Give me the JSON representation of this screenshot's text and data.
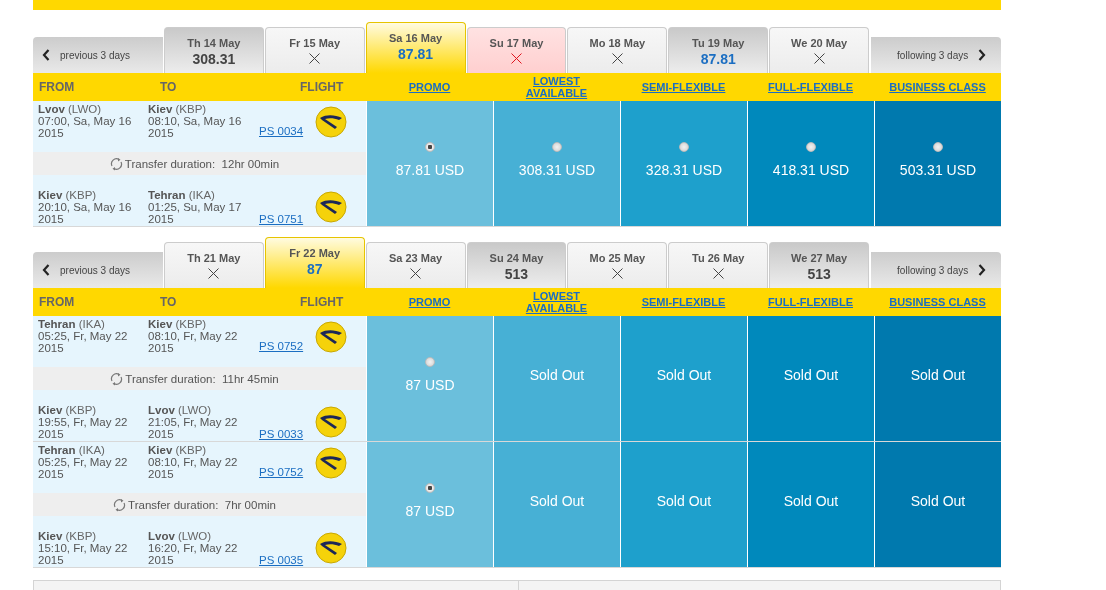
{
  "blocks": [
    {
      "prev_label": "previous 3 days",
      "next_label": "following 3 days",
      "dates": [
        {
          "label": "Th 14 May",
          "kind": "price",
          "price": "308.31",
          "highlighted": false,
          "selected": false
        },
        {
          "label": "Fr 15 May",
          "kind": "none",
          "selected": false
        },
        {
          "label": "Sa 16 May",
          "kind": "price",
          "price": "87.81",
          "highlighted": true,
          "selected": true
        },
        {
          "label": "Su 17 May",
          "kind": "blocked",
          "selected": false
        },
        {
          "label": "Mo 18 May",
          "kind": "none",
          "selected": false
        },
        {
          "label": "Tu 19 May",
          "kind": "price",
          "price": "87.81",
          "highlighted": true,
          "selected": false
        },
        {
          "label": "We 20 May",
          "kind": "none",
          "selected": false
        }
      ],
      "headers": {
        "from": "FROM",
        "to": "TO",
        "flight": "FLIGHT"
      },
      "fare_classes": [
        {
          "label": "PROMO",
          "color": "#6bbfdc"
        },
        {
          "label": "LOWEST AVAILABLE",
          "color": "#47b0d5"
        },
        {
          "label": "SEMI-FLEXIBLE",
          "color": "#1ea0cc"
        },
        {
          "label": "FULL-FLEXIBLE",
          "color": "#0089bc"
        },
        {
          "label": "BUSINESS CLASS",
          "color": "#0079ae"
        }
      ],
      "itineraries": [
        {
          "segments": [
            {
              "from_city": "Lvov",
              "from_code": "(LWO)",
              "from_time": [
                "07:00, Sa, May 16",
                "2015"
              ],
              "to_city": "Kiev",
              "to_code": "(KBP)",
              "to_time": [
                "08:10, Sa, May 16",
                "2015"
              ],
              "flight": "PS 0034"
            },
            {
              "from_city": "Kiev",
              "from_code": "(KBP)",
              "from_time": [
                "20:10, Sa, May 16",
                "2015"
              ],
              "to_city": "Tehran",
              "to_code": "(IKA)",
              "to_time": [
                "01:25, Su, May 17",
                "2015"
              ],
              "flight": "PS 0751"
            }
          ],
          "transfer": {
            "label": "Transfer duration:",
            "duration": "12hr 00min"
          },
          "fares": [
            {
              "kind": "radio",
              "selected": true,
              "price": "87.81 USD"
            },
            {
              "kind": "radio",
              "selected": false,
              "price": "308.31 USD"
            },
            {
              "kind": "radio",
              "selected": false,
              "price": "328.31 USD"
            },
            {
              "kind": "radio",
              "selected": false,
              "price": "418.31 USD"
            },
            {
              "kind": "radio",
              "selected": false,
              "price": "503.31 USD"
            }
          ]
        }
      ]
    },
    {
      "prev_label": "previous 3 days",
      "next_label": "following 3 days",
      "dates": [
        {
          "label": "Th 21 May",
          "kind": "none",
          "selected": false
        },
        {
          "label": "Fr 22 May",
          "kind": "price",
          "price": "87",
          "highlighted": true,
          "selected": true
        },
        {
          "label": "Sa 23 May",
          "kind": "none",
          "selected": false
        },
        {
          "label": "Su 24 May",
          "kind": "price",
          "price": "513",
          "highlighted": false,
          "selected": false
        },
        {
          "label": "Mo 25 May",
          "kind": "none",
          "selected": false
        },
        {
          "label": "Tu 26 May",
          "kind": "none",
          "selected": false
        },
        {
          "label": "We 27 May",
          "kind": "price",
          "price": "513",
          "highlighted": false,
          "selected": false
        }
      ],
      "headers": {
        "from": "FROM",
        "to": "TO",
        "flight": "FLIGHT"
      },
      "fare_classes": [
        {
          "label": "PROMO",
          "color": "#6bbfdc"
        },
        {
          "label": "LOWEST AVAILABLE",
          "color": "#47b0d5"
        },
        {
          "label": "SEMI-FLEXIBLE",
          "color": "#1ea0cc"
        },
        {
          "label": "FULL-FLEXIBLE",
          "color": "#0089bc"
        },
        {
          "label": "BUSINESS CLASS",
          "color": "#0079ae"
        }
      ],
      "itineraries": [
        {
          "segments": [
            {
              "from_city": "Tehran",
              "from_code": "(IKA)",
              "from_time": [
                "05:25, Fr, May 22",
                "2015"
              ],
              "to_city": "Kiev",
              "to_code": "(KBP)",
              "to_time": [
                "08:10, Fr, May 22",
                "2015"
              ],
              "flight": "PS 0752"
            },
            {
              "from_city": "Kiev",
              "from_code": "(KBP)",
              "from_time": [
                "19:55, Fr, May 22",
                "2015"
              ],
              "to_city": "Lvov",
              "to_code": "(LWO)",
              "to_time": [
                "21:05, Fr, May 22",
                "2015"
              ],
              "flight": "PS 0033"
            }
          ],
          "transfer": {
            "label": "Transfer duration:",
            "duration": "11hr 45min"
          },
          "fares": [
            {
              "kind": "radio",
              "selected": false,
              "price": "87 USD"
            },
            {
              "kind": "sold_out",
              "label": "Sold Out"
            },
            {
              "kind": "sold_out",
              "label": "Sold Out"
            },
            {
              "kind": "sold_out",
              "label": "Sold Out"
            },
            {
              "kind": "sold_out",
              "label": "Sold Out"
            }
          ]
        },
        {
          "segments": [
            {
              "from_city": "Tehran",
              "from_code": "(IKA)",
              "from_time": [
                "05:25, Fr, May 22",
                "2015"
              ],
              "to_city": "Kiev",
              "to_code": "(KBP)",
              "to_time": [
                "08:10, Fr, May 22",
                "2015"
              ],
              "flight": "PS 0752"
            },
            {
              "from_city": "Kiev",
              "from_code": "(KBP)",
              "from_time": [
                "15:10, Fr, May 22",
                "2015"
              ],
              "to_city": "Lvov",
              "to_code": "(LWO)",
              "to_time": [
                "16:20, Fr, May 22",
                "2015"
              ],
              "flight": "PS 0035"
            }
          ],
          "transfer": {
            "label": "Transfer duration:",
            "duration": "7hr 00min"
          },
          "fares": [
            {
              "kind": "radio",
              "selected": true,
              "price": "87 USD"
            },
            {
              "kind": "sold_out",
              "label": "Sold Out"
            },
            {
              "kind": "sold_out",
              "label": "Sold Out"
            },
            {
              "kind": "sold_out",
              "label": "Sold Out"
            },
            {
              "kind": "sold_out",
              "label": "Sold Out"
            }
          ]
        }
      ]
    }
  ]
}
